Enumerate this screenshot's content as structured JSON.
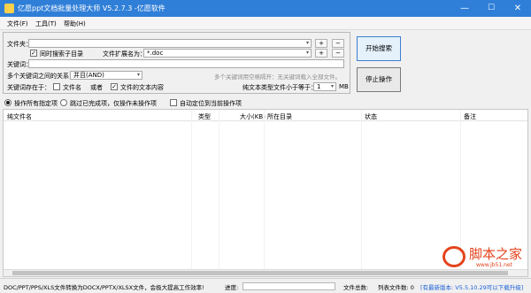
{
  "window": {
    "title": "亿愿ppt文档批量处理大师 V5.2.7.3 -亿愿软件",
    "minimize": "—",
    "maximize": "☐",
    "close": "✕"
  },
  "menu": [
    "文件(F)",
    "工具(T)",
    "帮助(H)"
  ],
  "form": {
    "folder_label": "文件夹：",
    "folder_value": "",
    "subdir_label": "同时搜索子目录",
    "subdir_checked": true,
    "ext_label": "文件扩展名为：",
    "ext_value": "*.doc",
    "keyword_label": "关键词：",
    "keyword_value": "",
    "relation_label": "多个关键词之间的关系：",
    "relation_value": "并且(AND)",
    "multi_hint": "多个关键词用空格隔开：无关键词载入全部文件。",
    "location_label": "关键词存在于：",
    "loc_filename": "文件名",
    "loc_or": "或者",
    "loc_content": "文件的文本内容",
    "loc_filename_checked": false,
    "loc_content_checked": true,
    "size_label": "纯文本类型文件小于等于：",
    "size_value": "1",
    "size_unit": "MB",
    "plus": "+",
    "minus": "−"
  },
  "buttons": {
    "start": "开始搜索",
    "stop": "停止操作"
  },
  "options": {
    "all_label": "操作所有指定项",
    "skip_label": "跳过已完成项，仅操作未操作项",
    "selected": "all",
    "autolocate_label": "自动定位到当前操作项",
    "autolocate_checked": false
  },
  "table": {
    "columns": [
      "纯文件名",
      "类型",
      "大小(KB)",
      "所在目录",
      "状态",
      "备注"
    ],
    "rows": []
  },
  "watermark": {
    "text": "脚本之家",
    "url": "www.jb51.net"
  },
  "status": {
    "tip": "DOC/PPT/PPS/XLS文件转换为DOCX/PPTX/XLSX文件，会极大提高工作效率!",
    "progress_label": "进度:",
    "progress": 0,
    "file_total": "文件总数:",
    "list_count": "列表文件数: 0",
    "update": "[有最新版本: V5.5.10.29可以下载升级]"
  }
}
